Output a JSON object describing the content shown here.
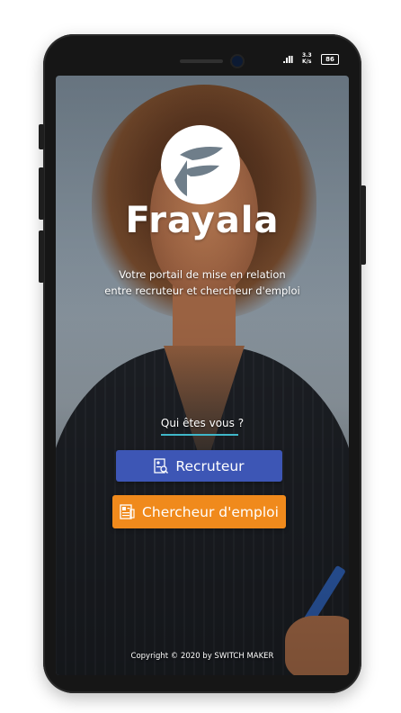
{
  "status_bar": {
    "signal": ".ıll",
    "speed_value": "3.3",
    "speed_unit": "K/s",
    "battery": "86"
  },
  "brand": {
    "name": "Frayala",
    "logo_icon": "frayala-f-leaf-logo",
    "tagline_line1": "Votre portail de mise en relation",
    "tagline_line2": "entre recruteur et chercheur d'emploi"
  },
  "role_prompt": {
    "question": "Qui êtes vous ?",
    "underline_color": "#3fb7c9"
  },
  "buttons": {
    "recruteur": {
      "label": "Recruteur",
      "icon": "recruiter-search-icon",
      "color": "#3d56b5"
    },
    "chercheur": {
      "label": "Chercheur d'emploi",
      "icon": "job-seeker-document-icon",
      "color": "#f08a1c"
    }
  },
  "footer": {
    "copyright": "Copyright © 2020 by SWITCH MAKER"
  }
}
